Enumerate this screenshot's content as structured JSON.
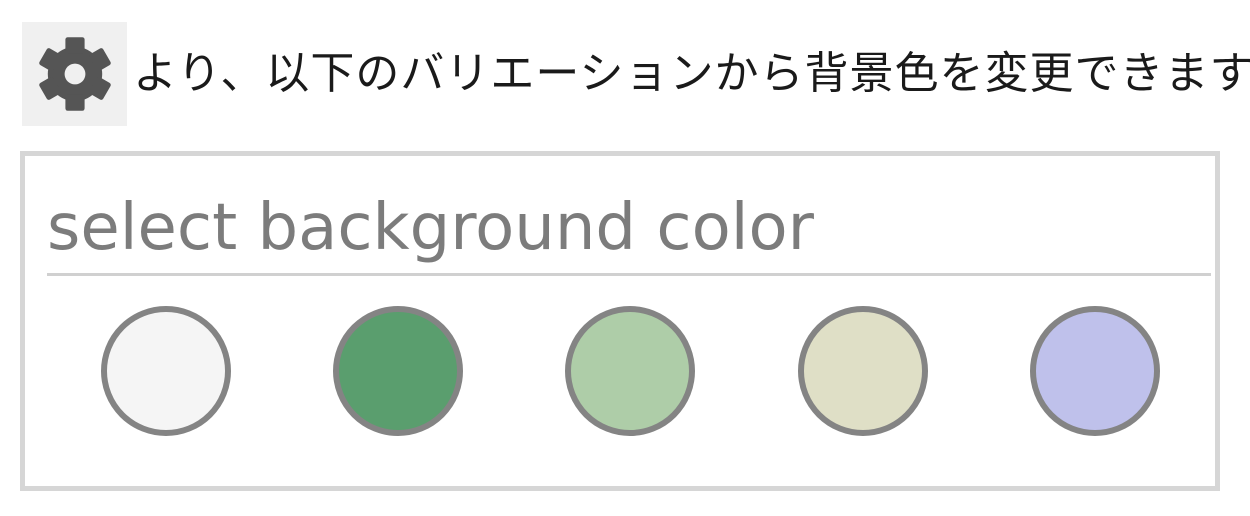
{
  "instruction": {
    "icon": "gear-icon",
    "text": "より、以下のバリエーションから背景色を変更できます。"
  },
  "picker": {
    "title": "select background color",
    "swatches": [
      {
        "color": "#f5f5f5"
      },
      {
        "color": "#5a9e6e"
      },
      {
        "color": "#aecda8"
      },
      {
        "color": "#dfdfc6"
      },
      {
        "color": "#bfc1eb"
      }
    ],
    "border_color": "#848484"
  }
}
